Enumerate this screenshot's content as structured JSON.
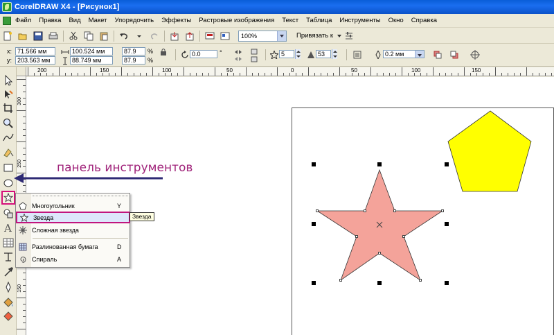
{
  "window": {
    "title": "CorelDRAW X4 - [Рисунок1]"
  },
  "menu": {
    "items": [
      "Файл",
      "Правка",
      "Вид",
      "Макет",
      "Упорядочить",
      "Эффекты",
      "Растровые изображения",
      "Текст",
      "Таблица",
      "Инструменты",
      "Окно",
      "Справка"
    ]
  },
  "standard_toolbar": {
    "zoom_value": "100%",
    "snap_label": "Привязать к"
  },
  "property_bar": {
    "x_label": "x:",
    "y_label": "y:",
    "x_value": "71.566 мм",
    "y_value": "203.563 мм",
    "width_value": "100.524 мм",
    "height_value": "88.749 мм",
    "scale_x": "87.9",
    "scale_y": "87.9",
    "pct_x": "%",
    "pct_y": "%",
    "rotation": "0.0",
    "rotation_unit": "°",
    "star_points": "5",
    "star_sharpness": "53",
    "outline_width": "0.2 мм"
  },
  "ruler": {
    "h_labels": [
      "200",
      "150",
      "100",
      "50",
      "0",
      "50",
      "100",
      "150"
    ],
    "v_labels": [
      "300",
      "250",
      "200",
      "150"
    ]
  },
  "annotation": {
    "text": "панель инструментов",
    "color": "#a0237a"
  },
  "flyout": {
    "items": [
      {
        "label": "Многоугольник",
        "key": "Y",
        "icon": "polygon-icon",
        "selected": false
      },
      {
        "label": "Звезда",
        "key": "",
        "icon": "star-icon",
        "selected": true
      },
      {
        "label": "Сложная звезда",
        "key": "",
        "icon": "complex-star-icon",
        "selected": false
      },
      {
        "label": "Разлинованная бумага",
        "key": "D",
        "icon": "graph-paper-icon",
        "selected": false
      },
      {
        "label": "Спираль",
        "key": "A",
        "icon": "spiral-icon",
        "selected": false
      }
    ],
    "tooltip": "Звезда"
  },
  "shapes": {
    "star_fill": "#f4a39a",
    "pentagon_fill": "#ffff00"
  },
  "colors": {
    "highlight": "#c1157e",
    "titlebar": "#0a5ed8"
  }
}
